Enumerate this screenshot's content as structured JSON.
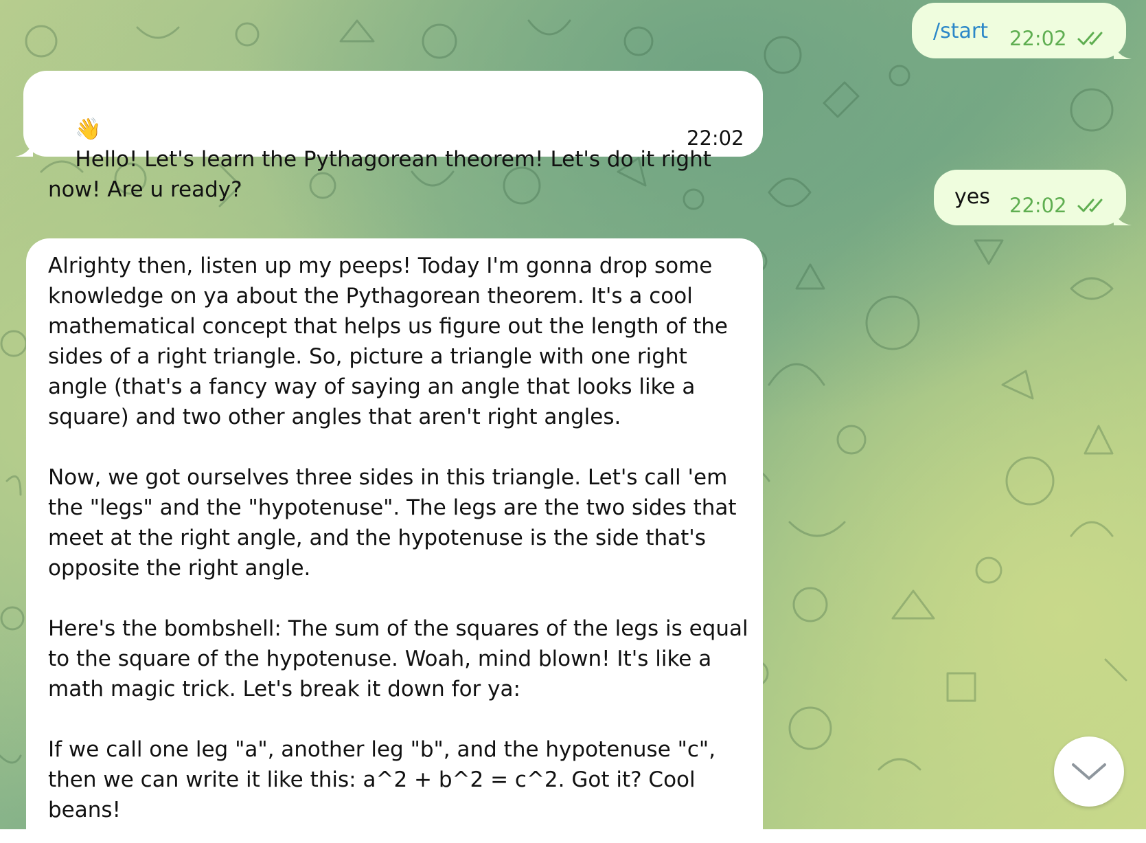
{
  "messages": [
    {
      "id": "start",
      "direction": "outgoing",
      "text": "/start",
      "time": "22:02",
      "status_icon": "double-check-icon"
    },
    {
      "id": "greeting",
      "direction": "incoming",
      "emoji": "👋",
      "text": "Hello! Let's learn the Pythagorean theorem! Let's do it right now! Are u ready?",
      "time": "22:02"
    },
    {
      "id": "yes",
      "direction": "outgoing",
      "text": "yes",
      "time": "22:02",
      "status_icon": "double-check-icon"
    },
    {
      "id": "explanation",
      "direction": "incoming",
      "paragraphs": [
        "Alrighty then, listen up my peeps! Today I'm gonna drop some knowledge on ya about the Pythagorean theorem. It's a cool mathematical concept that helps us figure out the length of the sides of a right triangle. So, picture a triangle with one right angle (that's a fancy way of saying an angle that looks like a square) and two other angles that aren't right angles.",
        "Now, we got ourselves three sides in this triangle. Let's call 'em the \"legs\" and the \"hypotenuse\". The legs are the two sides that meet at the right angle, and the hypotenuse is the side that's opposite the right angle.",
        "Here's the bombshell: The sum of the squares of the legs is equal to the square of the hypotenuse. Woah, mind blown! It's like a math magic trick. Let's break it down for ya:",
        "If we call one leg \"a\", another leg \"b\", and the hypotenuse \"c\", then we can write it like this: a^2 + b^2 = c^2. Got it? Cool beans!"
      ]
    }
  ],
  "scroll_button": {
    "icon": "chevron-down-icon"
  },
  "colors": {
    "incoming_bubble": "#ffffff",
    "outgoing_bubble": "#effdde",
    "outgoing_time": "#5fae51",
    "incoming_time": "#a1aab3",
    "command_link": "#2b87c8"
  }
}
